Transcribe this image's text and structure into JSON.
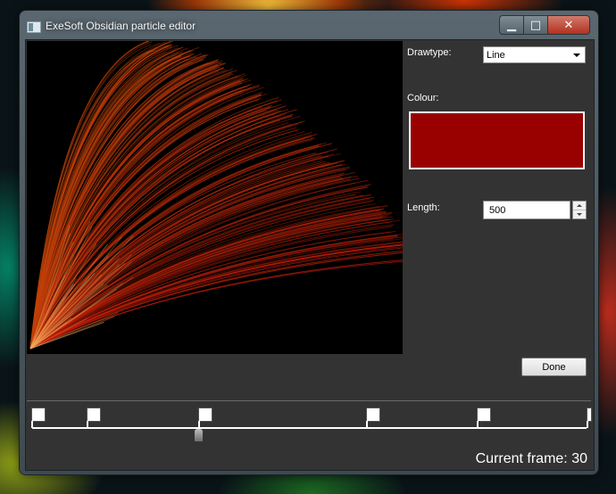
{
  "window": {
    "title": "ExeSoft Obsidian particle editor",
    "controls": {
      "minimize_icon": "minimize-icon",
      "maximize_icon": "maximize-icon",
      "close_icon": "close-icon"
    }
  },
  "properties": {
    "drawtype_label": "Drawtype:",
    "drawtype_value": "Line",
    "colour_label": "Colour:",
    "colour_value": "#990000",
    "length_label": "Length:",
    "length_value": "500"
  },
  "actions": {
    "done_label": "Done"
  },
  "timeline": {
    "keyframe_count": 6,
    "current_frame_text": "Current frame: 30"
  },
  "colors": {
    "canvas_background": "#000000",
    "particle_inner": "#f0a060",
    "particle_outer": "#b41e0a",
    "panel_background": "#333333"
  }
}
